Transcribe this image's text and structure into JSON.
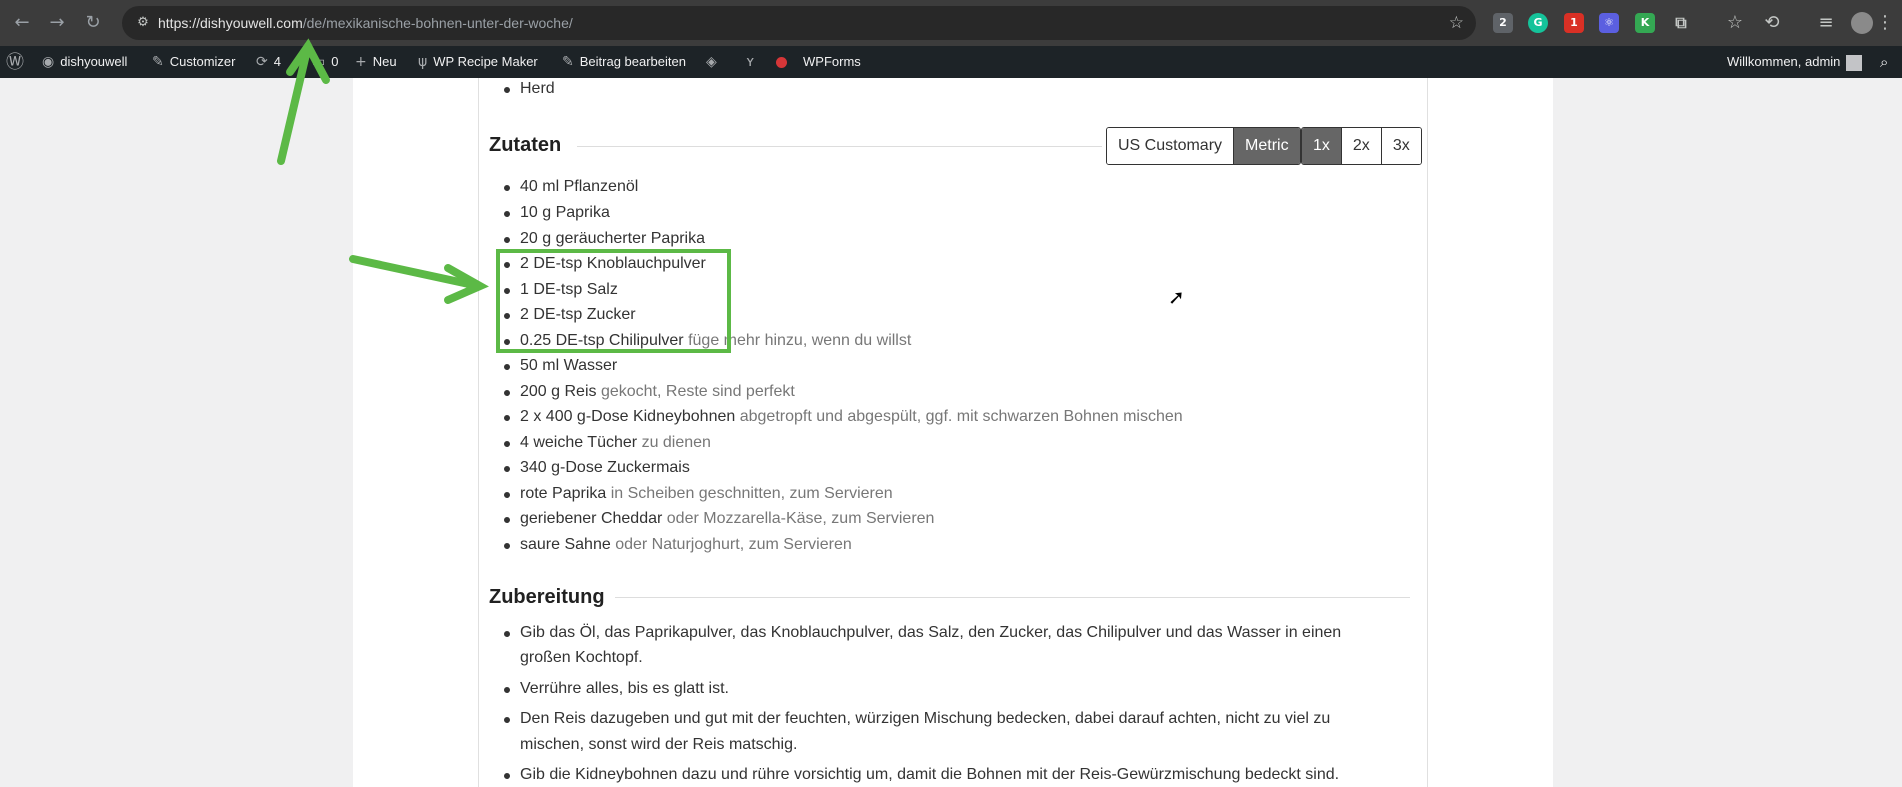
{
  "browser": {
    "url_host": "https://dishyouwell.com",
    "url_path": "/de/mexikanische-bohnen-unter-der-woche/",
    "nav_back": "←",
    "nav_forward": "→",
    "nav_reload": "↻",
    "tune_icon": "⚙",
    "bookmark_icon": "☆",
    "extensions": [
      {
        "name": "extension-badge-2",
        "label": "2",
        "color": "#5f6368"
      },
      {
        "name": "grammarly-icon",
        "label": "G",
        "color": "#15c39a"
      },
      {
        "name": "extension-badge-1",
        "label": "1",
        "color": "#d93025"
      },
      {
        "name": "extension-purple",
        "label": "⚛",
        "color": "#5b5fe0"
      },
      {
        "name": "extension-k",
        "label": "K",
        "color": "#34a853"
      },
      {
        "name": "puzzle-icon",
        "label": "⧉",
        "color": "transparent"
      }
    ]
  },
  "adminbar": {
    "wp_icon": "Ⓦ",
    "site": "dishyouwell",
    "customizer": "Customizer",
    "updates": "4",
    "comments": "0",
    "new": "Neu",
    "recipe_maker": "WP Recipe Maker",
    "edit_post": "Beitrag bearbeiten",
    "wpforms": "WPForms",
    "welcome": "Willkommen, admin"
  },
  "equipment": {
    "last_item": "Herd"
  },
  "ingredients": {
    "heading": "Zutaten",
    "units": {
      "us": "US Customary",
      "metric": "Metric",
      "active": "Metric"
    },
    "scale": {
      "x1": "1x",
      "x2": "2x",
      "x3": "3x",
      "active": "1x"
    },
    "items": [
      {
        "text": "40 ml Pflanzenöl",
        "note": ""
      },
      {
        "text": "10 g Paprika",
        "note": ""
      },
      {
        "text": "20 g geräucherter Paprika",
        "note": ""
      },
      {
        "text": "2 DE-tsp Knoblauchpulver",
        "note": ""
      },
      {
        "text": "1 DE-tsp Salz",
        "note": ""
      },
      {
        "text": "2 DE-tsp Zucker",
        "note": ""
      },
      {
        "text": "0.25 DE-tsp Chilipulver",
        "note": "füge mehr hinzu, wenn du willst"
      },
      {
        "text": "50 ml Wasser",
        "note": ""
      },
      {
        "text": "200 g Reis",
        "note": "gekocht, Reste sind perfekt"
      },
      {
        "text": "2 x 400 g-Dose Kidneybohnen",
        "note": "abgetropft und abgespült, ggf. mit schwarzen Bohnen mischen"
      },
      {
        "text": "4 weiche Tücher",
        "note": "zu dienen"
      },
      {
        "text": "340 g-Dose Zuckermais",
        "note": ""
      },
      {
        "text": "rote Paprika",
        "note": "in Scheiben geschnitten, zum Servieren"
      },
      {
        "text": "geriebener Cheddar",
        "note": "oder Mozzarella-Käse, zum Servieren"
      },
      {
        "text": "saure Sahne",
        "note": "oder Naturjoghurt, zum Servieren"
      }
    ]
  },
  "instructions": {
    "heading": "Zubereitung",
    "steps": [
      {
        "line1": "Gib das Öl, das Paprikapulver, das Knoblauchpulver, das Salz, den Zucker, das Chilipulver und das Wasser in einen",
        "line2": "großen Kochtopf."
      },
      {
        "line1": "Verrühre alles, bis es glatt ist.",
        "line2": ""
      },
      {
        "line1": "Den Reis dazugeben und gut mit der feuchten, würzigen Mischung bedecken, dabei darauf achten, nicht zu viel zu",
        "line2": "mischen, sonst wird der Reis matschig."
      },
      {
        "line1": "Gib die Kidneybohnen dazu und rühre vorsichtig um, damit die Bohnen mit der Reis-Gewürzmischung bedeckt sind.",
        "line2": ""
      }
    ]
  },
  "colors": {
    "annotation_green": "#5cb946",
    "active_button": "#666666"
  }
}
